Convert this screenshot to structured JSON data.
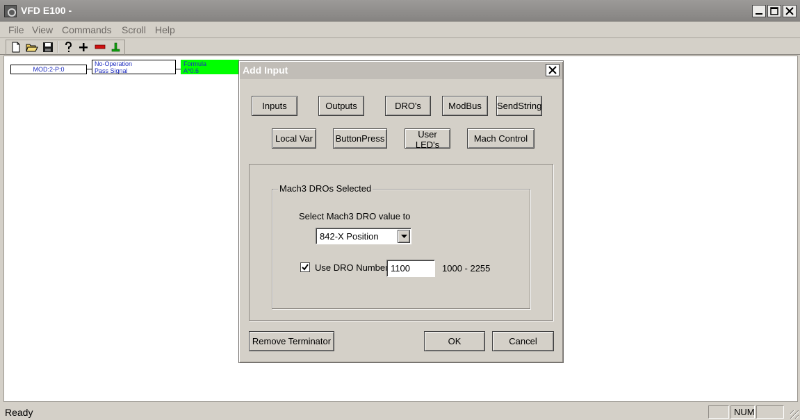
{
  "window": {
    "title": "VFD E100 -"
  },
  "menu": {
    "items": [
      "File",
      "View",
      "Commands",
      "Scroll",
      "Help"
    ]
  },
  "toolbar": {
    "icons": [
      "new-file-icon",
      "open-folder-icon",
      "save-icon",
      "help-icon",
      "add-icon",
      "remove-icon",
      "terminator-icon"
    ]
  },
  "canvas": {
    "nodes": [
      {
        "label": "MOD:2-P:0"
      },
      {
        "line1": "No-Operation",
        "line2": "Pass Signal"
      },
      {
        "line1": "Formula",
        "line2": "A*0.6"
      }
    ],
    "formula_node_color": "#00ff00"
  },
  "dialog": {
    "title": "Add Input",
    "category_buttons_row1": [
      "Inputs",
      "Outputs",
      "DRO's",
      "ModBus",
      "SendString"
    ],
    "category_buttons_row2": [
      "Local Var",
      "ButtonPress",
      "User LED's",
      "Mach Control"
    ],
    "group_title": "Mach3 DROs Selected",
    "select_label": "Select Mach3 DRO value to",
    "select_value": "842-X Position",
    "use_dro_checked": true,
    "use_dro_label": "Use DRO Number",
    "dro_number": "1100",
    "range_text": "1000 - 2255",
    "remove_terminator_label": "Remove Terminator",
    "ok_label": "OK",
    "cancel_label": "Cancel"
  },
  "status": {
    "text": "Ready",
    "panes": [
      "",
      "NUM",
      ""
    ]
  }
}
